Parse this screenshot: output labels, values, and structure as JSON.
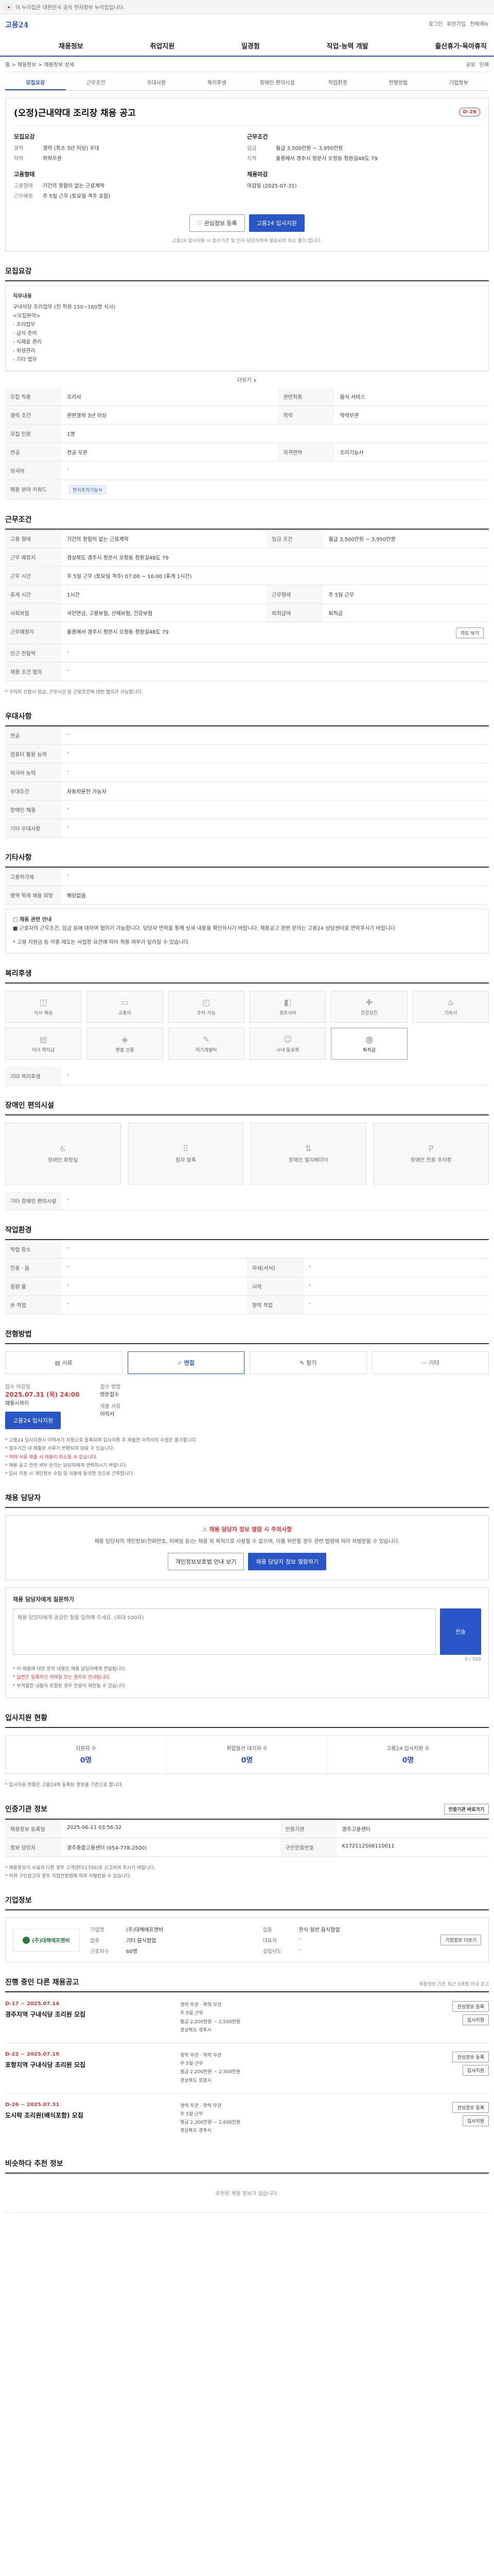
{
  "topbar": {
    "text": "이 누리집은 대한민국 공식 전자정부 누리집입니다."
  },
  "header": {
    "logo_main": "고용",
    "logo_sub": "24",
    "links": [
      "로그인",
      "회원가입",
      "전체메뉴"
    ],
    "nav": [
      "채용정보",
      "취업지원",
      "일경험",
      "직업·능력 개발",
      "출산휴가·육아휴직"
    ]
  },
  "crumb": {
    "path": "홈 > 채용정보 > 채용정보 상세",
    "actions": [
      "공유",
      "인쇄"
    ]
  },
  "subtabs": [
    "모집요강",
    "근무조건",
    "우대사항",
    "복리후생",
    "장애인 편의시설",
    "작업환경",
    "전형방법",
    "기업정보"
  ],
  "summary": {
    "title": "(오정)근내약대 조리장 채용 공고",
    "dday": "D-26",
    "left_head": "모집요강",
    "left": [
      {
        "k": "경력",
        "v": "경력 (최소 3년 이상) 우대"
      },
      {
        "k": "학력",
        "v": "학력무관"
      }
    ],
    "left_head2": "고용형태",
    "left2": [
      {
        "k": "고용형태",
        "v": "기간의 정함이 없는 근로계약"
      },
      {
        "k": "근무예정",
        "v": "주 5일 근무 (토요일 격주 포함)"
      }
    ],
    "right_head": "근무조건",
    "right": [
      {
        "k": "임금",
        "v": "월급 3,500만원 ~ 3,950만원"
      },
      {
        "k": "지역",
        "v": "울릉에서 경주시 정문시 오정동 정원길48도 79"
      }
    ],
    "right_head2": "채용마감",
    "right2": [
      {
        "k": "",
        "v": "마감일 (2025-07-31)"
      }
    ],
    "scrap_btn": "관심정보 등록",
    "apply_btn": "고용24 입사지원",
    "note": "고용24 입사지원 시 접수기관 및 인사 담당자에게 발송되며 취소 불가 합니다."
  },
  "recruit": {
    "title": "모집요강",
    "job_head": "직무내용",
    "job_lines": [
      "구내식당 조리업무 (전 직원 150~160명 식사)",
      "<모집분야>",
      "- 조리업무",
      "- 급식 준비",
      "- 식재료 관리",
      "- 위생관리",
      "- 기타 업무"
    ],
    "more": "더보기 ∨",
    "rows": [
      {
        "k": "모집 직종",
        "v": "조리사",
        "k2": "관련직종",
        "v2": "음식 서비스"
      },
      {
        "k": "경력 조건",
        "v": "관련경력 3년 이상",
        "k2": "학력",
        "v2": "학력무관"
      },
      {
        "k": "모집 인원",
        "v": "1명",
        "k2": "",
        "v2": ""
      },
      {
        "k": "전공",
        "v": "전공 무관",
        "k2": "자격면허",
        "v2": "조리기능사"
      },
      {
        "k": "외국어",
        "v": "-",
        "k2": "",
        "v2": ""
      },
      {
        "k": "채용 분야 키워드",
        "v": "한식조리기능사",
        "k2": "",
        "v2": ""
      }
    ]
  },
  "work": {
    "title": "근무조건",
    "rows": [
      {
        "k": "고용 형태",
        "v": "기간의 정함이 없는 근로계약",
        "k2": "임금 조건",
        "v2": "월급 3,500만원 ~ 3,950만원"
      },
      {
        "k": "근무 예정지",
        "v": "경상북도 경주시 정문시 오정동 정원길48도 79",
        "k2": "",
        "v2": ""
      },
      {
        "k": "근무 시간",
        "v": "주 5일 근무 (토요일 격주) 07:00 ~ 16:00 (휴게 1시간)",
        "k2": "",
        "v2": ""
      },
      {
        "k": "휴게 시간",
        "v": "1시간",
        "k2": "근무형태",
        "v2": "주 5일 근무"
      },
      {
        "k": "사회보험",
        "v": "국민연금, 고용보험, 산재보험, 건강보험",
        "k2": "퇴직급여",
        "v2": "퇴직금"
      },
      {
        "k": "근무예정지",
        "v": "울릉에서 경주시 정문시 오정동 정원길48도 79",
        "k2": "",
        "v2": ""
      },
      {
        "k": "인근 전철역",
        "v": "-",
        "k2": "",
        "v2": ""
      },
      {
        "k": "채용 조건 협의",
        "v": "-",
        "k2": "",
        "v2": ""
      }
    ],
    "map_btn": "지도 보기",
    "note": "* 구직자 신청시 임금, 근무시간 등 근로조건에 대한 협의가 가능합니다."
  },
  "pref": {
    "title": "우대사항",
    "rows": [
      {
        "k": "전공",
        "v": "-"
      },
      {
        "k": "컴퓨터 활용 능력",
        "v": "-"
      },
      {
        "k": "외국어 능력",
        "v": "-"
      },
      {
        "k": "우대조건",
        "v": "자동차운전 가능자"
      },
      {
        "k": "장애인 채용",
        "v": "-"
      },
      {
        "k": "기타 우대사항",
        "v": "-"
      }
    ]
  },
  "etc": {
    "title": "기타사항",
    "rows": [
      {
        "k": "고용허가제",
        "v": "-"
      },
      {
        "k": "병역 특례 채용 희망",
        "v": "해당없음"
      }
    ],
    "detail_head": "□ 채용 관련 안내",
    "detail": "■ 근로자의 근무조건, 임금 등에 대하여 협의가 가능합니다. 담당자 연락을 통해 상세 내용을 확인하시기 바랍니다. 채용공고 관련 문의는 고용24 상담센터로 연락주시기 바랍니다.",
    "detail2": "* 고용 지원금 등 각종 제도는 사업장 요건에 따라 적용 여부가 달라질 수 있습니다."
  },
  "welfare": {
    "title": "복리후생",
    "items": [
      {
        "label": "식사 제공",
        "icon": "meal-icon",
        "on": false
      },
      {
        "label": "교통비",
        "icon": "bus-icon",
        "on": false
      },
      {
        "label": "주차 가능",
        "icon": "car-icon",
        "on": false
      },
      {
        "label": "경조사비",
        "icon": "gift-icon",
        "on": false
      },
      {
        "label": "건강검진",
        "icon": "health-icon",
        "on": false
      },
      {
        "label": "기숙사",
        "icon": "house-icon",
        "on": false
      },
      {
        "label": "자녀 학자금",
        "icon": "book-icon",
        "on": false
      },
      {
        "label": "명절 선물",
        "icon": "present-icon",
        "on": false
      },
      {
        "label": "자기계발비",
        "icon": "study-icon",
        "on": false
      },
      {
        "label": "사내 동호회",
        "icon": "people-icon",
        "on": false
      },
      {
        "label": "퇴직금",
        "icon": "coin-icon",
        "on": true
      }
    ],
    "row_k": "기타 복리후생",
    "row_v": "-"
  },
  "facility": {
    "title": "장애인 편의시설",
    "items": [
      {
        "label": "장애인 화장실",
        "icon": "toilet-icon"
      },
      {
        "label": "점자 블록",
        "icon": "braille-icon"
      },
      {
        "label": "장애인 엘리베이터",
        "icon": "elevator-icon"
      },
      {
        "label": "장애인 전용 주차장",
        "icon": "parking-icon"
      }
    ],
    "row_k": "기타 장애인 편의시설",
    "row_v": "-"
  },
  "env": {
    "title": "작업환경",
    "rows": [
      {
        "k": "작업 장소",
        "v": "-",
        "k2": "",
        "v2": ""
      },
      {
        "k": "진동 · 음",
        "v": "-",
        "k2": "자세(서서)",
        "v2": "-"
      },
      {
        "k": "중량 물",
        "v": "-",
        "k2": "시력",
        "v2": "-"
      },
      {
        "k": "손 작업",
        "v": "-",
        "k2": "청력 작업",
        "v2": "-"
      }
    ]
  },
  "process": {
    "title": "전형방법",
    "steps": [
      {
        "label": "서류",
        "on": false
      },
      {
        "label": "면접",
        "on": true
      },
      {
        "label": "필기",
        "on": false
      },
      {
        "label": "기타",
        "on": false
      }
    ],
    "period_k": "접수 마감일",
    "period_v": "2025.07.31 (목) 24:00",
    "period_sub": "채용시까지",
    "method_k": "접수 방법",
    "method_v": "방문접수",
    "doc_k": "제출 서류",
    "doc_v": "이력서",
    "apply_btn": "고용24 입사지원",
    "notices": [
      "* 고용24 입사지원시 이력서가 자동으로 등록되며 입사지원 후 제출한 이력서의 수정은 불가합니다.",
      "* 접수기간 내 제출된 서류가 반환되지 않을 수 있습니다.",
      "* 허위 서류 제출 시 채용이 취소될 수 있습니다.",
      "* 채용 공고 관련 세부 문의는 담당자에게 연락하시기 바랍니다.",
      "* 입사 지원 시 개인정보 수집 및 이용에 동의한 것으로 간주합니다."
    ]
  },
  "contact": {
    "title": "채용 담당자",
    "warn": "채용 담당자 정보 열람 시 주의사항",
    "p": "채용 담당자의 개인정보(전화번호, 이메일 등)는 채용 외 목적으로 사용할 수 없으며, 이를 위반할 경우 관련 법령에 따라 처벌받을 수 있습니다.",
    "btn1": "개인정보보호법 안내 보기",
    "btn2": "채용 담당자 정보 열람하기",
    "report_head": "채용 담당자에게 질문하기",
    "report_placeholder": "채용 담당자에게 궁금한 점을 입력해 주세요. (최대 500자)",
    "report_btn": "전송",
    "report_notes": [
      "* 이 채용에 대한 문의 내용은 채용 담당자에게 전달됩니다.",
      "* 답변은 등록하신 이메일 또는 문자로 안내됩니다.",
      "* 부적절한 내용이 포함된 경우 전송이 제한될 수 있습니다."
    ],
    "report_count": "0 / 500"
  },
  "status": {
    "title": "입사지원 현황",
    "items": [
      {
        "label": "지원자 수",
        "value": "0명"
      },
      {
        "label": "취업알선 대기자 수",
        "value": "0명"
      },
      {
        "label": "고용24 입사지원 수",
        "value": "0명"
      }
    ],
    "note": "* 입사지원 현황은 고용24에 등록된 정보를 기준으로 합니다."
  },
  "manage": {
    "title": "인증기관 정보",
    "btn": "인증기관 바로가기",
    "rows": [
      {
        "k": "채용정보 등록일",
        "v": "2025-06-11 03:56:32",
        "k2": "인증기관",
        "v2": "경주고용센터"
      },
      {
        "k": "정보 담당자",
        "v": "경주종합고용센터 (054-778-2500)",
        "k2": "구인인증번호",
        "v2": "K172112506110011"
      }
    ],
    "notes": [
      "* 채용정보가 사실과 다른 경우 고객센터(1350)로 신고하여 주시기 바랍니다.",
      "* 허위 구인광고의 경우 직업안정법에 따라 처벌받을 수 있습니다."
    ]
  },
  "company": {
    "title": "기업정보",
    "logo": "(주)대해에프앤비",
    "btn": "기업정보 더보기",
    "rows": [
      {
        "k": "기업명",
        "v": "(주)대해에프앤비",
        "k2": "업종",
        "v2": "한식 일반 음식점업"
      },
      {
        "k": "업종",
        "v": "기타 음식점업",
        "k2": "대표자",
        "v2": "-"
      },
      {
        "k": "근로자수",
        "v": "60명",
        "k2": "설립년도",
        "v2": "-"
      }
    ]
  },
  "other": {
    "title": "진행 중인 다른 채용공고",
    "note": "채용정보 기준 최근 3개월 이내 공고",
    "jobs": [
      {
        "date": "D-17 ~ 2025.07.14",
        "title": "경주지역 구내식당 조리원 모집",
        "info": [
          "경력 무관 · 학력 무관",
          "주 5일 근무",
          "월급 2,200만원 ~ 2,500만원",
          "경상북도 경주시"
        ],
        "btns": [
          "관심정보 등록",
          "입사지원"
        ]
      },
      {
        "date": "D-22 ~ 2025.07.19",
        "title": "포항지역 구내식당 조리원 모집",
        "info": [
          "경력 무관 · 학력 무관",
          "주 5일 근무",
          "월급 2,200만원 ~ 2,500만원",
          "경상북도 포항시"
        ],
        "btns": [
          "관심정보 등록",
          "입사지원"
        ]
      },
      {
        "date": "D-26 ~ 2025.07.31",
        "title": "도시락 조리원(배식포함) 모집",
        "info": [
          "경력 무관 · 학력 무관",
          "주 5일 근무",
          "월급 2,300만원 ~ 2,600만원",
          "경상북도 경주시"
        ],
        "btns": [
          "관심정보 등록",
          "입사지원"
        ]
      }
    ]
  },
  "recent": {
    "title": "비슷하다 추천 정보",
    "empty": "추천된 채용 정보가 없습니다."
  }
}
